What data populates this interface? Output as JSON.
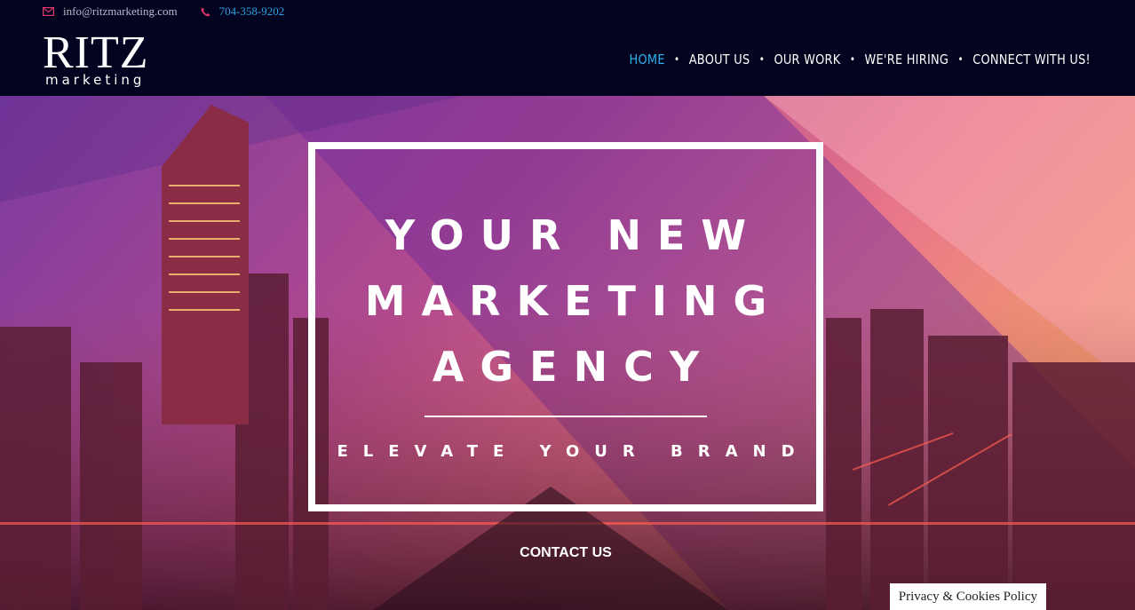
{
  "contact": {
    "email": "info@ritzmarketing.com",
    "phone": "704-358-9202",
    "email_icon": "envelope-icon",
    "phone_icon": "phone-icon"
  },
  "logo": {
    "main": "RITZ",
    "sub": "marketing"
  },
  "nav": {
    "items": [
      {
        "label": "HOME",
        "active": true
      },
      {
        "label": "ABOUT US"
      },
      {
        "label": "OUR WORK"
      },
      {
        "label": "WE'RE HIRING"
      },
      {
        "label": "CONNECT WITH US!"
      }
    ],
    "separator": "•"
  },
  "hero": {
    "headline": [
      "YOUR NEW",
      "MARKETING",
      "AGENCY"
    ],
    "tagline": "ELEVATE YOUR BRAND",
    "cta": "CONTACT US"
  },
  "privacy": {
    "label": "Privacy & Cookies Policy"
  },
  "colors": {
    "topbar": "#02031f",
    "accent_blue": "#2fb0ee",
    "icon_pink": "#e0366b"
  }
}
